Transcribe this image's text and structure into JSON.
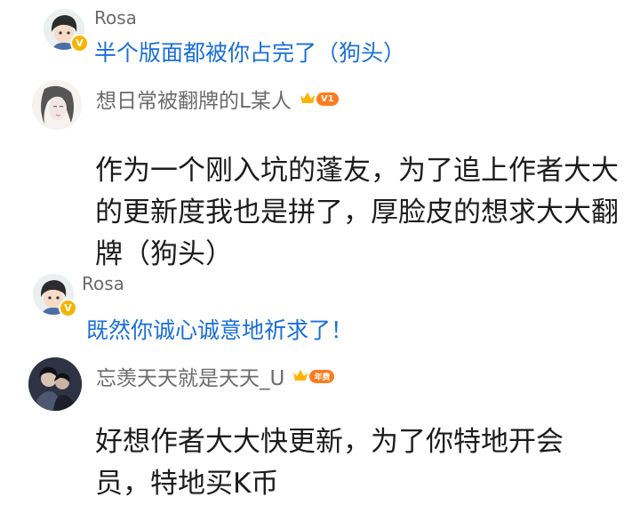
{
  "comments": [
    {
      "user": "Rosa",
      "text": "半个版面都被你占完了（狗头）",
      "avatar_icon": "cartoon-boy-avatar",
      "verified": true
    },
    {
      "user": "想日常被翻牌的L某人",
      "badge": "V1",
      "text": "作为一个刚入坑的蓬友，为了追上作者大大的更新度我也是拼了，厚脸皮的想求大大翻牌（狗头）",
      "avatar_icon": "sketch-girl-avatar",
      "crown_icon": "crown-icon"
    },
    {
      "user": "Rosa",
      "text": "既然你诚心诚意地祈求了！",
      "avatar_icon": "cartoon-boy-avatar",
      "verified": true
    },
    {
      "user": "忘羡天天就是天天_U",
      "badge": "年费",
      "text": "好想作者大大快更新，为了你特地开会员，特地买K币",
      "avatar_icon": "dark-couple-avatar",
      "crown_icon": "crown-icon"
    }
  ],
  "colors": {
    "reply_blue": "#1a6fd6",
    "name_gray": "#6b6b6b",
    "badge_orange": "#ff7b1c",
    "crown_gold": "#ffb300",
    "verified_gold": "#f5b400"
  }
}
